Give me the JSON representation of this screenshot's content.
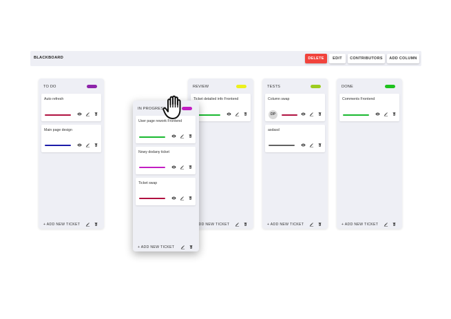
{
  "board": {
    "title": "BLACKBOARD",
    "buttons": {
      "delete": "DELETE",
      "edit": "EDIT",
      "contributors": "CONTRIBUTORS",
      "add_column": "ADD COLUMN"
    }
  },
  "add_ticket_label": "+ ADD NEW TICKET",
  "icons": {
    "view": "eye-icon",
    "edit": "pencil-icon",
    "delete": "trash-icon",
    "cursor": "grab-hand-icon"
  },
  "columns": [
    {
      "title": "TO DO",
      "color": "#8e24aa",
      "tickets": [
        {
          "title": "Auto refresh",
          "color": "#b0103f"
        },
        {
          "title": "Main page design",
          "color": "#1a1aa8"
        }
      ]
    },
    {
      "title": "IN PROGRESS",
      "color": "#c21dc2",
      "tickets": [
        {
          "title": "User page rework Frontend",
          "color": "#17b82e"
        },
        {
          "title": "Nowy dodany ticket",
          "color": "#c21dc2"
        },
        {
          "title": "Ticket swap",
          "color": "#b0103f"
        }
      ]
    },
    {
      "title": "REVIEW",
      "color": "#ecf01e",
      "tickets": [
        {
          "title": "Ticket detailed info Frontend",
          "color": "#17b82e"
        }
      ]
    },
    {
      "title": "TESTS",
      "color": "#9ccc1f",
      "tickets": [
        {
          "title": "Column swap",
          "color": "#b0103f",
          "assignee": "DP"
        },
        {
          "title": "asdasd",
          "color": "#616161"
        }
      ]
    },
    {
      "title": "DONE",
      "color": "#1ec21e",
      "tickets": [
        {
          "title": "Comments Frontend",
          "color": "#17b82e"
        }
      ]
    }
  ]
}
